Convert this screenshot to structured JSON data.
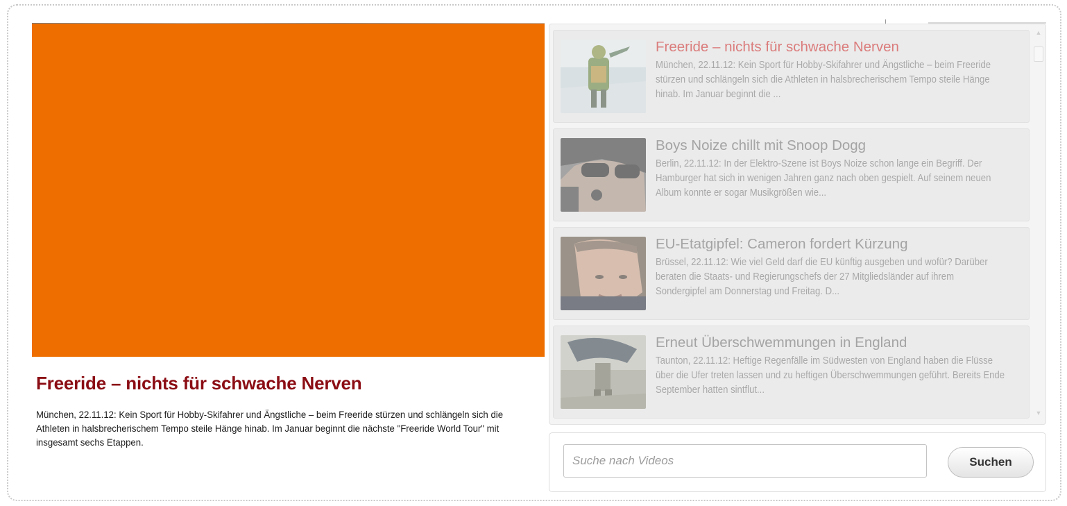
{
  "player": {
    "title": "Freeride – nichts für schwache Nerven",
    "description": "München, 22.11.12: Kein Sport für Hobby-Skifahrer und Ängstliche – beim Freeride stürzen und schlängeln sich die Athleten in halsbrecherischem Tempo steile Hänge hinab. Im Januar beginnt die nächste \"Freeride World Tour\" mit insgesamt sechs Etappen."
  },
  "playlist": [
    {
      "title": "Freeride – nichts für schwache Nerven",
      "text": "München, 22.11.12: Kein Sport für Hobby-Skifahrer und Ängstliche – beim Freeride stürzen und schlängeln sich die Athleten in halsbrecherischem Tempo steile Hänge hinab. Im Januar beginnt die ...",
      "active": true
    },
    {
      "title": "Boys Noize chillt mit Snoop Dogg",
      "text": "Berlin, 22.11.12: In der Elektro-Szene ist Boys Noize schon lange ein Begriff. Der Hamburger hat sich in wenigen Jahren ganz nach oben gespielt. Auf seinem neuen Album konnte er sogar Musikgrößen wie...",
      "active": false
    },
    {
      "title": "EU-Etatgipfel: Cameron fordert Kürzung",
      "text": "Brüssel, 22.11.12: Wie viel Geld darf die EU künftig ausgeben und wofür? Darüber beraten die Staats- und Regierungschefs der 27 Mitgliedsländer auf ihrem Sondergipfel am Donnerstag und Freitag. D...",
      "active": false
    },
    {
      "title": "Erneut Überschwemmungen in England",
      "text": "Taunton, 22.11.12: Heftige Regenfälle im Südwesten von England haben die Flüsse über die Ufer treten lassen und zu heftigen Überschwemmungen geführt. Bereits Ende September hatten sintflut...",
      "active": false
    }
  ],
  "scrollbar": {
    "up_icon": "▲",
    "down_icon": "▼"
  },
  "search": {
    "placeholder": "Suche nach Videos",
    "value": "",
    "button_label": "Suchen"
  },
  "colors": {
    "player_background": "#ee6e00",
    "title_red": "#8b0d14",
    "active_item_title": "#db7c7c"
  }
}
